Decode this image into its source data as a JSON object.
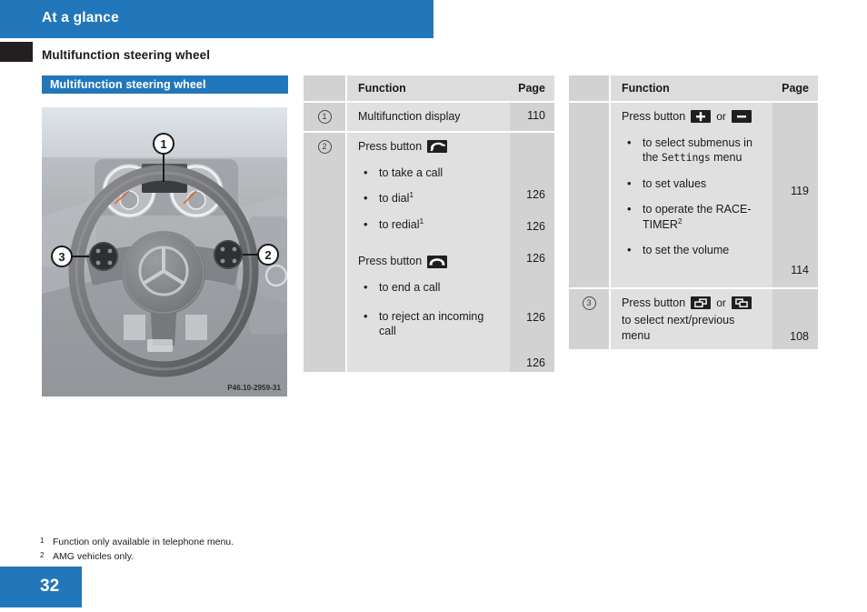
{
  "header": {
    "chapter": "At a glance",
    "section_title": "Multifunction steering wheel",
    "subhead": "Multifunction steering wheel"
  },
  "colors": {
    "accent_blue": "#2277bb",
    "tab_black": "#231f20",
    "table_num_bg": "#d2d2d2",
    "table_fn_bg": "#e0e0e0",
    "table_header_bg": "#dcdcdc"
  },
  "figure": {
    "name": "multifunction-steering-wheel-photo",
    "code": "P46.10-2959-31",
    "callouts": [
      "1",
      "2",
      "3"
    ]
  },
  "tables": {
    "middle": {
      "headers": {
        "function": "Function",
        "page": "Page"
      },
      "rows": [
        {
          "num": "1",
          "lines": [
            {
              "text": "Multifunction display",
              "page": "110"
            }
          ]
        },
        {
          "num": "2",
          "groups": [
            {
              "press_label": "Press button",
              "icon": "phone-offhook-icon",
              "items": [
                {
                  "text": "to take a call",
                  "sup": "",
                  "page": "126"
                },
                {
                  "text": "to dial",
                  "sup": "1",
                  "page": "126"
                },
                {
                  "text": "to redial",
                  "sup": "1",
                  "page": "126"
                }
              ]
            },
            {
              "press_label": "Press button",
              "icon": "phone-onhook-icon",
              "items": [
                {
                  "text": "to end a call",
                  "sup": "",
                  "page": "126"
                },
                {
                  "text": "to reject an incoming call",
                  "sup": "",
                  "page": "126"
                }
              ]
            }
          ]
        }
      ]
    },
    "right": {
      "headers": {
        "function": "Function",
        "page": "Page"
      },
      "rows": [
        {
          "num": "",
          "press_label": "Press button",
          "icon_a": "plus-key-icon",
          "or_label": "or",
          "icon_b": "minus-key-icon",
          "items": [
            {
              "pre": "to select submenus in the ",
              "mono": "Settings",
              "post": " menu",
              "page": "119"
            },
            {
              "pre": "to set values",
              "mono": "",
              "post": "",
              "page": ""
            },
            {
              "pre": "to operate the RACE-TIMER",
              "sup": "2",
              "mono": "",
              "post": "",
              "page": "114"
            },
            {
              "pre": "to set the volume",
              "mono": "",
              "post": "",
              "page": ""
            }
          ]
        },
        {
          "num": "3",
          "press_label": "Press button",
          "icon_a": "next-menu-icon",
          "or_label": "or",
          "icon_b": "previous-menu-icon",
          "tail": "to select next/previous menu",
          "page": "108"
        }
      ]
    }
  },
  "footnotes": [
    {
      "marker": "1",
      "text": "Function only available in telephone menu."
    },
    {
      "marker": "2",
      "text": "AMG vehicles only."
    }
  ],
  "page_number": "32"
}
